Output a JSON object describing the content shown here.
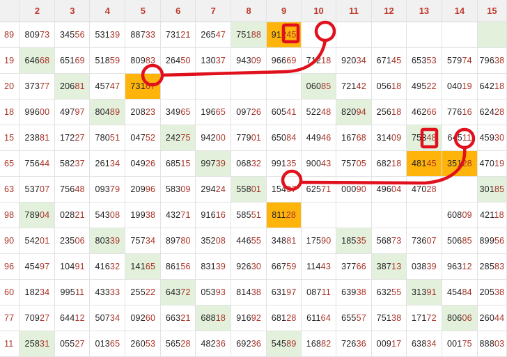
{
  "header": [
    "",
    "2",
    "3",
    "4",
    "5",
    "6",
    "7",
    "8",
    "9",
    "10",
    "11",
    "12",
    "13",
    "14",
    "15"
  ],
  "rows": [
    [
      "89",
      "80973",
      "34556",
      "53139",
      "88733",
      "73121",
      "26547",
      "75188",
      "91245",
      "",
      "",
      "",
      "",
      "",
      ""
    ],
    [
      "19",
      "64668",
      "65169",
      "51859",
      "80983",
      "26450",
      "13037",
      "94309",
      "96669",
      "71218",
      "92034",
      "67145",
      "65353",
      "57974",
      "79638"
    ],
    [
      "20",
      "37377",
      "20681",
      "45747",
      "73167",
      "",
      "",
      "",
      "",
      "06085",
      "72142",
      "05618",
      "49522",
      "04019",
      "64218"
    ],
    [
      "18",
      "99600",
      "49797",
      "80489",
      "20823",
      "34965",
      "19665",
      "09726",
      "60541",
      "52248",
      "82094",
      "25618",
      "46266",
      "77616",
      "62428"
    ],
    [
      "15",
      "23881",
      "17227",
      "78051",
      "04752",
      "24275",
      "94200",
      "77901",
      "65084",
      "44946",
      "16768",
      "31409",
      "75348",
      "64511",
      "45930"
    ],
    [
      "65",
      "75644",
      "58237",
      "26134",
      "04926",
      "68515",
      "99739",
      "06832",
      "99135",
      "90043",
      "75705",
      "68218",
      "48145",
      "35128",
      "47019"
    ],
    [
      "63",
      "53707",
      "75648",
      "09379",
      "20996",
      "58309",
      "29424",
      "55801",
      "15437",
      "62571",
      "00090",
      "49604",
      "47028",
      "",
      "30185"
    ],
    [
      "98",
      "78904",
      "02821",
      "54308",
      "19938",
      "43271",
      "91616",
      "58551",
      "81128",
      "",
      "",
      "",
      "",
      "60809",
      "42118"
    ],
    [
      "90",
      "54201",
      "23506",
      "80339",
      "75734",
      "89780",
      "35208",
      "44655",
      "34881",
      "17590",
      "18535",
      "56873",
      "73607",
      "50685",
      "89956"
    ],
    [
      "96",
      "45497",
      "10491",
      "41632",
      "14165",
      "86156",
      "83139",
      "92630",
      "66759",
      "11443",
      "37766",
      "38713",
      "03839",
      "96312",
      "28583"
    ],
    [
      "60",
      "18234",
      "99511",
      "43333",
      "25522",
      "64372",
      "05393",
      "81438",
      "63197",
      "08711",
      "63938",
      "63255",
      "31391",
      "45484",
      "20538"
    ],
    [
      "77",
      "70927",
      "64412",
      "50734",
      "09260",
      "66321",
      "68818",
      "91692",
      "68128",
      "61164",
      "65557",
      "75138",
      "17172",
      "80606",
      "26044"
    ],
    [
      "11",
      "25831",
      "05527",
      "01365",
      "26053",
      "56528",
      "48236",
      "69236",
      "54589",
      "16882",
      "72636",
      "00917",
      "63834",
      "00175",
      "88803"
    ]
  ],
  "green_cells": [
    [
      0,
      7
    ],
    [
      0,
      14
    ],
    [
      1,
      1
    ],
    [
      2,
      2
    ],
    [
      2,
      9
    ],
    [
      3,
      3
    ],
    [
      3,
      10
    ],
    [
      4,
      5
    ],
    [
      4,
      12
    ],
    [
      5,
      6
    ],
    [
      6,
      7
    ],
    [
      6,
      14
    ],
    [
      7,
      1
    ],
    [
      8,
      3
    ],
    [
      8,
      10
    ],
    [
      9,
      4
    ],
    [
      9,
      11
    ],
    [
      10,
      5
    ],
    [
      10,
      12
    ],
    [
      11,
      6
    ],
    [
      11,
      13
    ],
    [
      12,
      1
    ],
    [
      12,
      8
    ]
  ],
  "orange_cells": [
    [
      0,
      8
    ],
    [
      2,
      4
    ],
    [
      5,
      12
    ],
    [
      5,
      13
    ],
    [
      7,
      8
    ]
  ],
  "colors": {
    "highlight_orange": "#ffb40c",
    "highlight_green": "#e3f1dc",
    "annotation_red": "#e0111d",
    "header_text": "#c0392b"
  }
}
